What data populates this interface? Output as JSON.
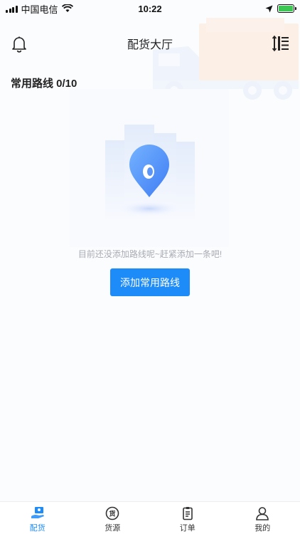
{
  "status_bar": {
    "carrier": "中国电信",
    "time": "10:22"
  },
  "header": {
    "title": "配货大厅",
    "left_icon": "bell-icon",
    "right_icon": "sort-list-icon"
  },
  "routes": {
    "section_title": "常用路线 0/10",
    "empty_message": "目前还没添加路线呢~赶紧添加一条吧!",
    "add_button_label": "添加常用路线"
  },
  "tab_bar": {
    "tabs": [
      {
        "label": "配货",
        "icon": "dispatch-truck-icon",
        "active": true
      },
      {
        "label": "货源",
        "icon": "goods-source-icon",
        "active": false
      },
      {
        "label": "订单",
        "icon": "clipboard-icon",
        "active": false
      },
      {
        "label": "我的",
        "icon": "user-icon",
        "active": false
      }
    ]
  },
  "colors": {
    "accent": "#1d8cf8",
    "background": "#fbfcfe"
  }
}
